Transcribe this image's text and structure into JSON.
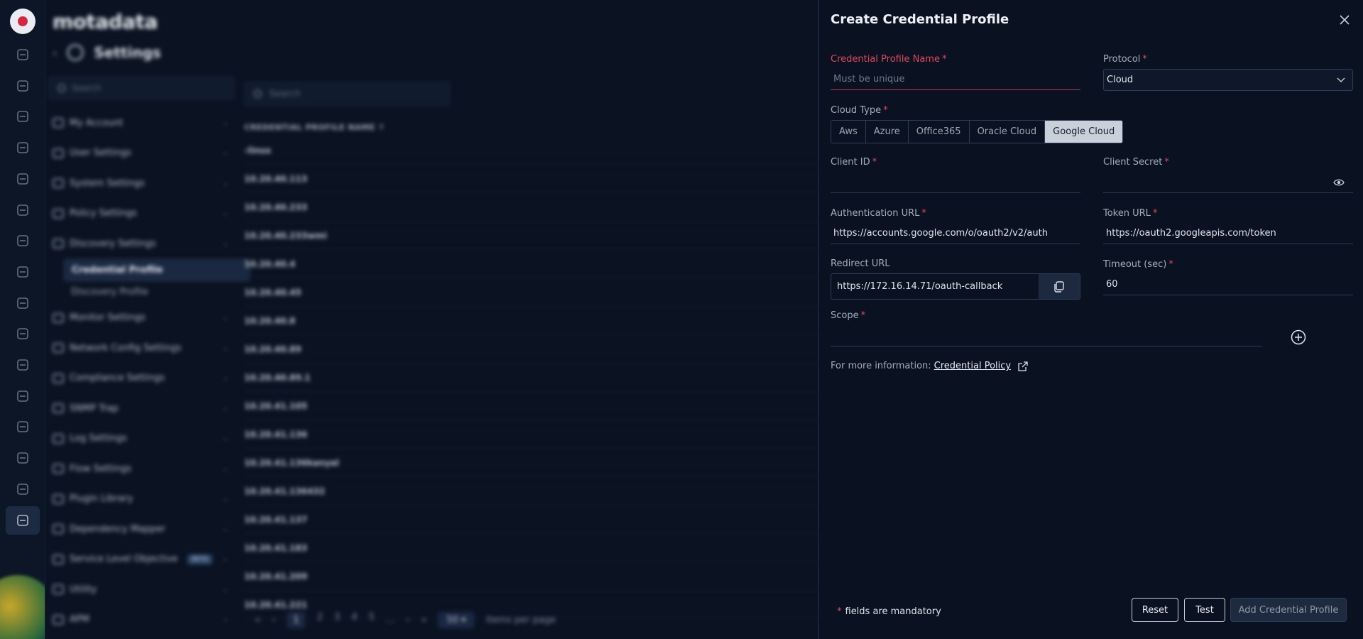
{
  "rail": {
    "icons": [
      "dashboard-icon",
      "monitor-icon",
      "alert-icon",
      "topology-icon",
      "log-icon",
      "network-icon",
      "flow-icon",
      "policy-icon",
      "metric-icon",
      "report-icon",
      "display-icon",
      "chat-icon",
      "user-group-icon",
      "robot-icon",
      "document-icon",
      "settings-icon"
    ]
  },
  "background": {
    "brand": "motadata",
    "settings_title": "Settings",
    "sidebar_search_placeholder": "Search",
    "sidebar_items": [
      {
        "label": "My Account"
      },
      {
        "label": "User Settings"
      },
      {
        "label": "System Settings"
      },
      {
        "label": "Policy Settings"
      },
      {
        "label": "Discovery Settings"
      }
    ],
    "sidebar_subitems": [
      "Credential Profile",
      "Discovery Profile"
    ],
    "sidebar_items_after": [
      {
        "label": "Monitor Settings"
      },
      {
        "label": "Network Config Settings"
      },
      {
        "label": "Compliance Settings"
      },
      {
        "label": "SNMP Trap"
      },
      {
        "label": "Log Settings"
      },
      {
        "label": "Flow Settings"
      },
      {
        "label": "Plugin Library"
      },
      {
        "label": "Dependency Mapper"
      },
      {
        "label": "Service Level Objective"
      },
      {
        "label": "Utility"
      },
      {
        "label": "APM"
      }
    ],
    "beta_badge": "BETA",
    "list_search_placeholder": "Search",
    "column_header": "CREDENTIAL PROFILE NAME ↑",
    "rows": [
      "-linux",
      "10.20.40.113",
      "10.20.40.233",
      "10.20.40.233wmi",
      "10.20.40.4",
      "10.20.40.45",
      "10.20.40.8",
      "10.20.40.89",
      "10.20.40.89.1",
      "10.20.41.105",
      "10.20.41.136",
      "10.20.41.136kanyal",
      "10.20.41.136432",
      "10.20.41.137",
      "10.20.41.183",
      "10.20.41.209",
      "10.20.41.221"
    ],
    "pager": {
      "pages": [
        "1",
        "2",
        "3",
        "4",
        "5"
      ],
      "ellipsis": "...",
      "per_page": "50",
      "per_page_label": "items per page"
    }
  },
  "drawer": {
    "title": "Create Credential Profile",
    "profile_name": {
      "label": "Credential Profile Name",
      "placeholder": "Must be unique",
      "value": ""
    },
    "protocol": {
      "label": "Protocol",
      "value": "Cloud"
    },
    "cloud_type": {
      "label": "Cloud Type",
      "options": [
        "Aws",
        "Azure",
        "Office365",
        "Oracle Cloud",
        "Google Cloud"
      ],
      "selected": "Google Cloud"
    },
    "client_id": {
      "label": "Client ID",
      "value": ""
    },
    "client_secret": {
      "label": "Client Secret",
      "value": ""
    },
    "auth_url": {
      "label": "Authentication URL",
      "value": "https://accounts.google.com/o/oauth2/v2/auth"
    },
    "token_url": {
      "label": "Token URL",
      "value": "https://oauth2.googleapis.com/token"
    },
    "redirect_url": {
      "label": "Redirect URL",
      "value": "https://172.16.14.71/oauth-callback"
    },
    "timeout": {
      "label": "Timeout (sec)",
      "value": "60"
    },
    "scope": {
      "label": "Scope",
      "value": ""
    },
    "info": {
      "prefix": "For more information:",
      "link": "Credential Policy"
    },
    "footer": {
      "mandatory_text": "fields are mandatory",
      "reset": "Reset",
      "test": "Test",
      "submit": "Add Credential Profile"
    },
    "required_mark": "*"
  }
}
